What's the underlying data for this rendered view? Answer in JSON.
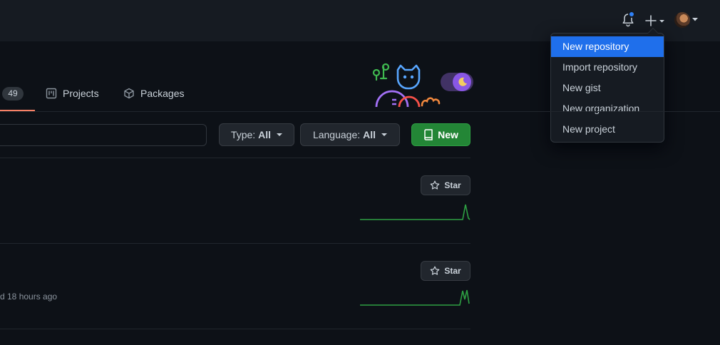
{
  "header": {
    "icons": [
      "bell-icon",
      "plus-icon",
      "avatar"
    ],
    "notification_color": "#2f81f7"
  },
  "new_menu": {
    "items": [
      {
        "label": "New repository",
        "active": true
      },
      {
        "label": "Import repository",
        "active": false
      },
      {
        "label": "New gist",
        "active": false
      },
      {
        "label": "New organization",
        "active": false
      },
      {
        "label": "New project",
        "active": false
      }
    ]
  },
  "tabs": {
    "repositories_count": "49",
    "projects_label": "Projects",
    "packages_label": "Packages"
  },
  "filters": {
    "search_placeholder": "",
    "type_prefix": "Type:",
    "type_value": "All",
    "language_prefix": "Language:",
    "language_value": "All",
    "new_label": "New"
  },
  "repos": [
    {
      "star_label": "Star",
      "updated": ""
    },
    {
      "star_label": "Star",
      "updated": "d 18 hours ago"
    }
  ],
  "colors": {
    "background": "#0d1117",
    "header": "#161b22",
    "accent_blue": "#1f6feb",
    "green_button": "#238636",
    "sparkline": "#2ea043",
    "tab_underline": "#f78166"
  }
}
